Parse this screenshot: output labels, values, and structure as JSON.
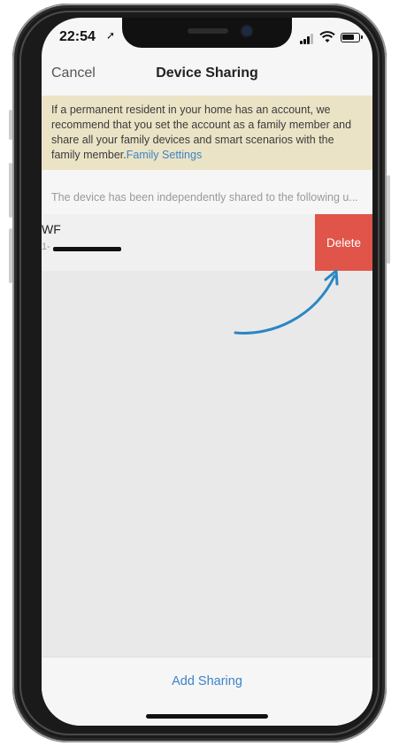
{
  "status": {
    "time": "22:54"
  },
  "nav": {
    "cancel": "Cancel",
    "title": "Device Sharing"
  },
  "notice": {
    "text": "If a permanent resident in your home has an account, we recommend that you set the account as a family member and share all your family devices and smart scenarios with the family member.",
    "link": "Family Settings"
  },
  "section": {
    "header": "The device has been independently shared to the following u..."
  },
  "shared_users": [
    {
      "name": "WF",
      "id_prefix": "1-",
      "delete_label": "Delete"
    }
  ],
  "footer": {
    "add_sharing": "Add Sharing"
  },
  "colors": {
    "link": "#3c85c8",
    "delete": "#e0544a",
    "notice_bg": "#ebe3c6",
    "arrow": "#2a86c4"
  }
}
